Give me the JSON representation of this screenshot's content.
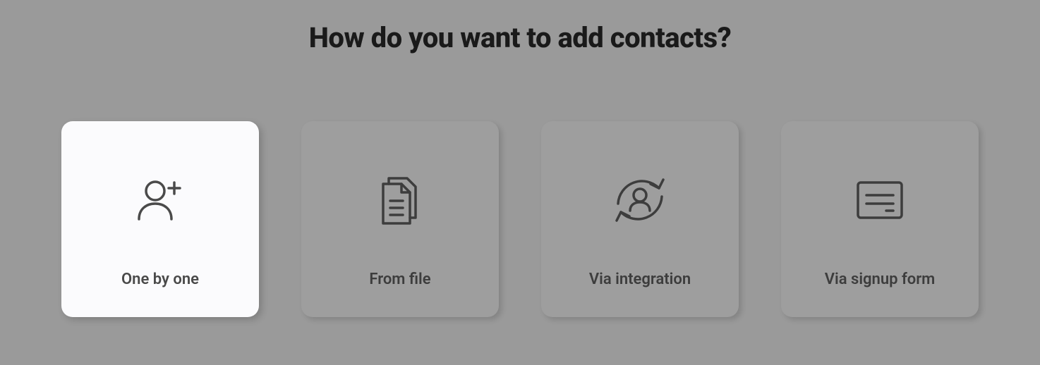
{
  "title": "How do you want to add contacts?",
  "cards": [
    {
      "label": "One by one",
      "icon": "person-add-icon",
      "selected": true
    },
    {
      "label": "From file",
      "icon": "file-icon",
      "selected": false
    },
    {
      "label": "Via integration",
      "icon": "sync-person-icon",
      "selected": false
    },
    {
      "label": "Via signup form",
      "icon": "form-icon",
      "selected": false
    }
  ]
}
